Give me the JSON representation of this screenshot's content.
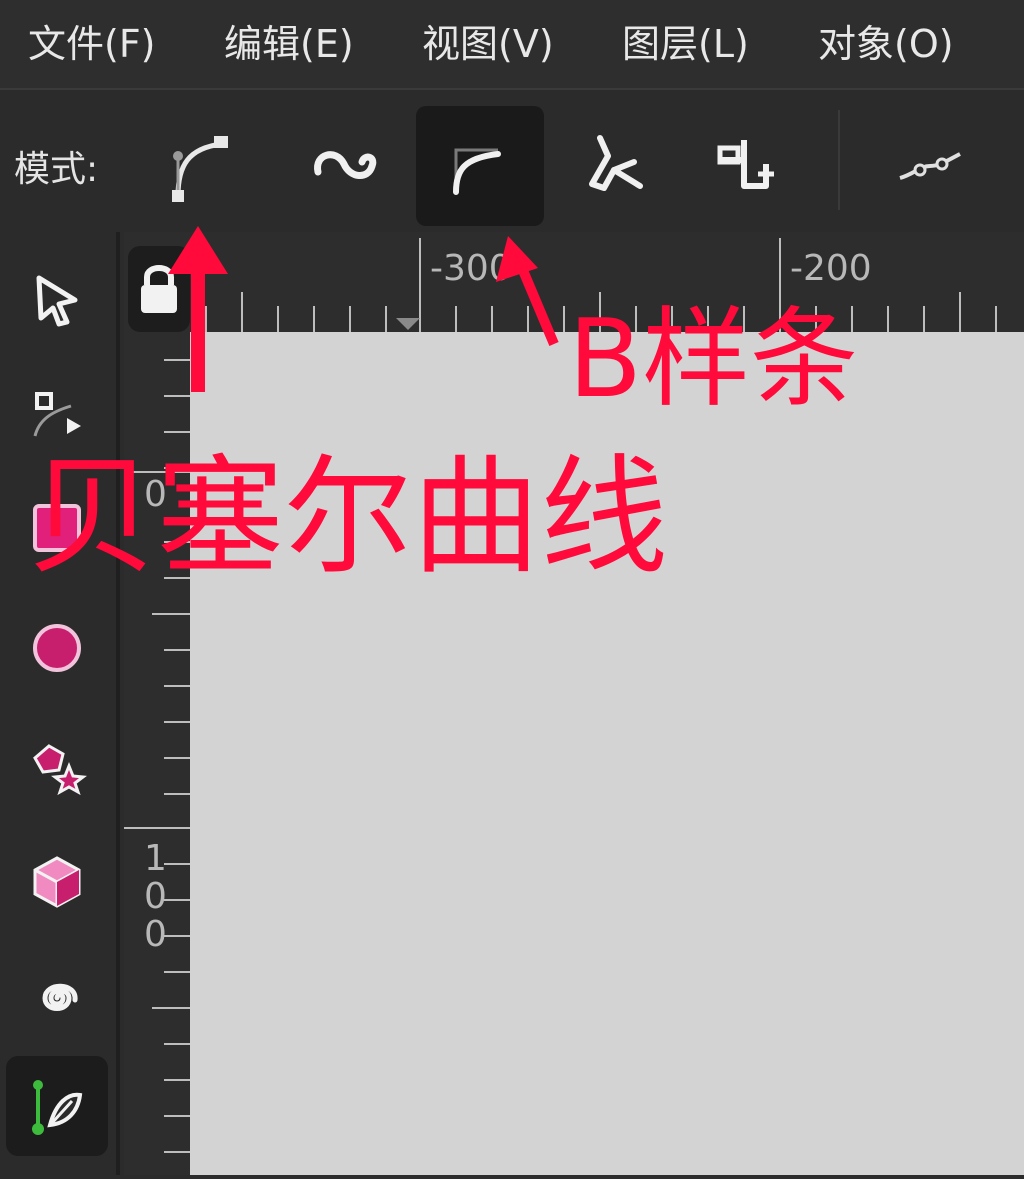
{
  "menu": {
    "items": [
      {
        "label": "文件(F)"
      },
      {
        "label": "编辑(E)"
      },
      {
        "label": "视图(V)"
      },
      {
        "label": "图层(L)"
      },
      {
        "label": "对象(O)"
      }
    ]
  },
  "toolbar": {
    "mode_label": "模式:",
    "modes": [
      {
        "icon": "bezier-mode-icon",
        "active": false
      },
      {
        "icon": "spiro-mode-icon",
        "active": false
      },
      {
        "icon": "bspline-mode-icon",
        "active": true
      },
      {
        "icon": "paraxial-mode-icon",
        "active": false
      },
      {
        "icon": "sequence-mode-icon",
        "active": false
      },
      {
        "icon": "shape-icon",
        "active": false
      }
    ]
  },
  "ruler": {
    "top_labels": [
      "-300",
      "-200"
    ],
    "left_labels": [
      "0",
      "1",
      "0",
      "0"
    ]
  },
  "toolbox": {
    "tools": [
      {
        "icon": "selector-arrow-icon"
      },
      {
        "icon": "node-tool-icon"
      },
      {
        "icon": "rectangle-icon"
      },
      {
        "icon": "circle-icon"
      },
      {
        "icon": "star-polygon-icon"
      },
      {
        "icon": "3d-box-icon"
      },
      {
        "icon": "spiral-icon"
      },
      {
        "icon": "pen-bezier-icon"
      }
    ]
  },
  "annotations": {
    "bspline": "B样条",
    "bezier": "贝塞尔曲线"
  },
  "colors": {
    "accent_pink": "#e0207a",
    "annotation_red": "#ff0a3a",
    "canvas": "#d3d3d3",
    "ui_dark": "#2b2b2b"
  }
}
